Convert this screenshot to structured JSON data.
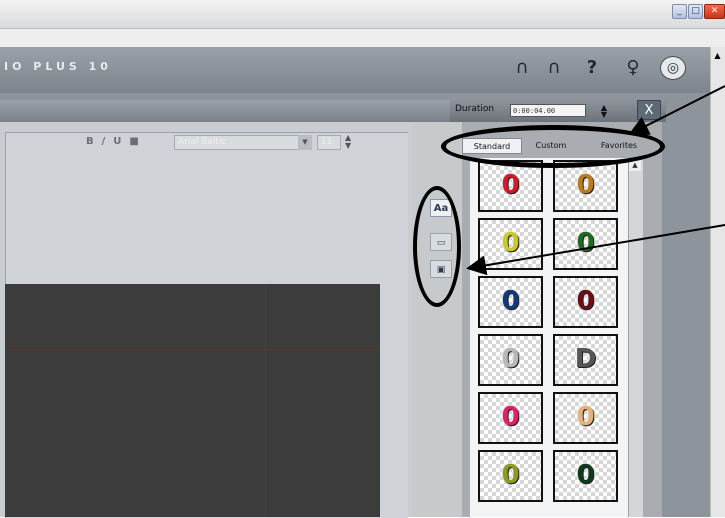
{
  "window": {
    "controls": [
      "minimize",
      "maximize",
      "close"
    ]
  },
  "app": {
    "title": "IO PLUS 10",
    "header_icons": [
      "undo-icon",
      "redo-icon",
      "help-icon",
      "lightbulb-icon",
      "disc-icon"
    ]
  },
  "panel": {
    "duration_label": "Duration",
    "duration_value": "0:00:04.00",
    "close_label": "X"
  },
  "editor": {
    "toolbar_icons": [
      "bold-icon",
      "italic-icon",
      "underline-icon",
      "align-icon"
    ],
    "font_name": "Arial Baltic",
    "font_size": "11"
  },
  "sidebar": {
    "text_tab": "Aa",
    "frame_tab": "▭",
    "image_tab": "▣"
  },
  "gallery": {
    "tabs": [
      "Standard",
      "Custom",
      "Favorites"
    ],
    "active_tab": "Standard",
    "presets": [
      {
        "glyph": "0",
        "color": "#d01a2a"
      },
      {
        "glyph": "0",
        "color": "#b87a22"
      },
      {
        "glyph": "0",
        "color": "#c9c92a"
      },
      {
        "glyph": "0",
        "color": "#1e6a1e"
      },
      {
        "glyph": "0",
        "color": "#123a7a"
      },
      {
        "glyph": "0",
        "color": "#6a0f1a"
      },
      {
        "glyph": "0",
        "color": "#b8b8b8"
      },
      {
        "glyph": "D",
        "color": "#555555"
      },
      {
        "glyph": "0",
        "color": "#e01f6a"
      },
      {
        "glyph": "0",
        "color": "#e4b27a"
      },
      {
        "glyph": "0",
        "color": "#8a9a22"
      },
      {
        "glyph": "0",
        "color": "#0e3a1e"
      }
    ]
  }
}
